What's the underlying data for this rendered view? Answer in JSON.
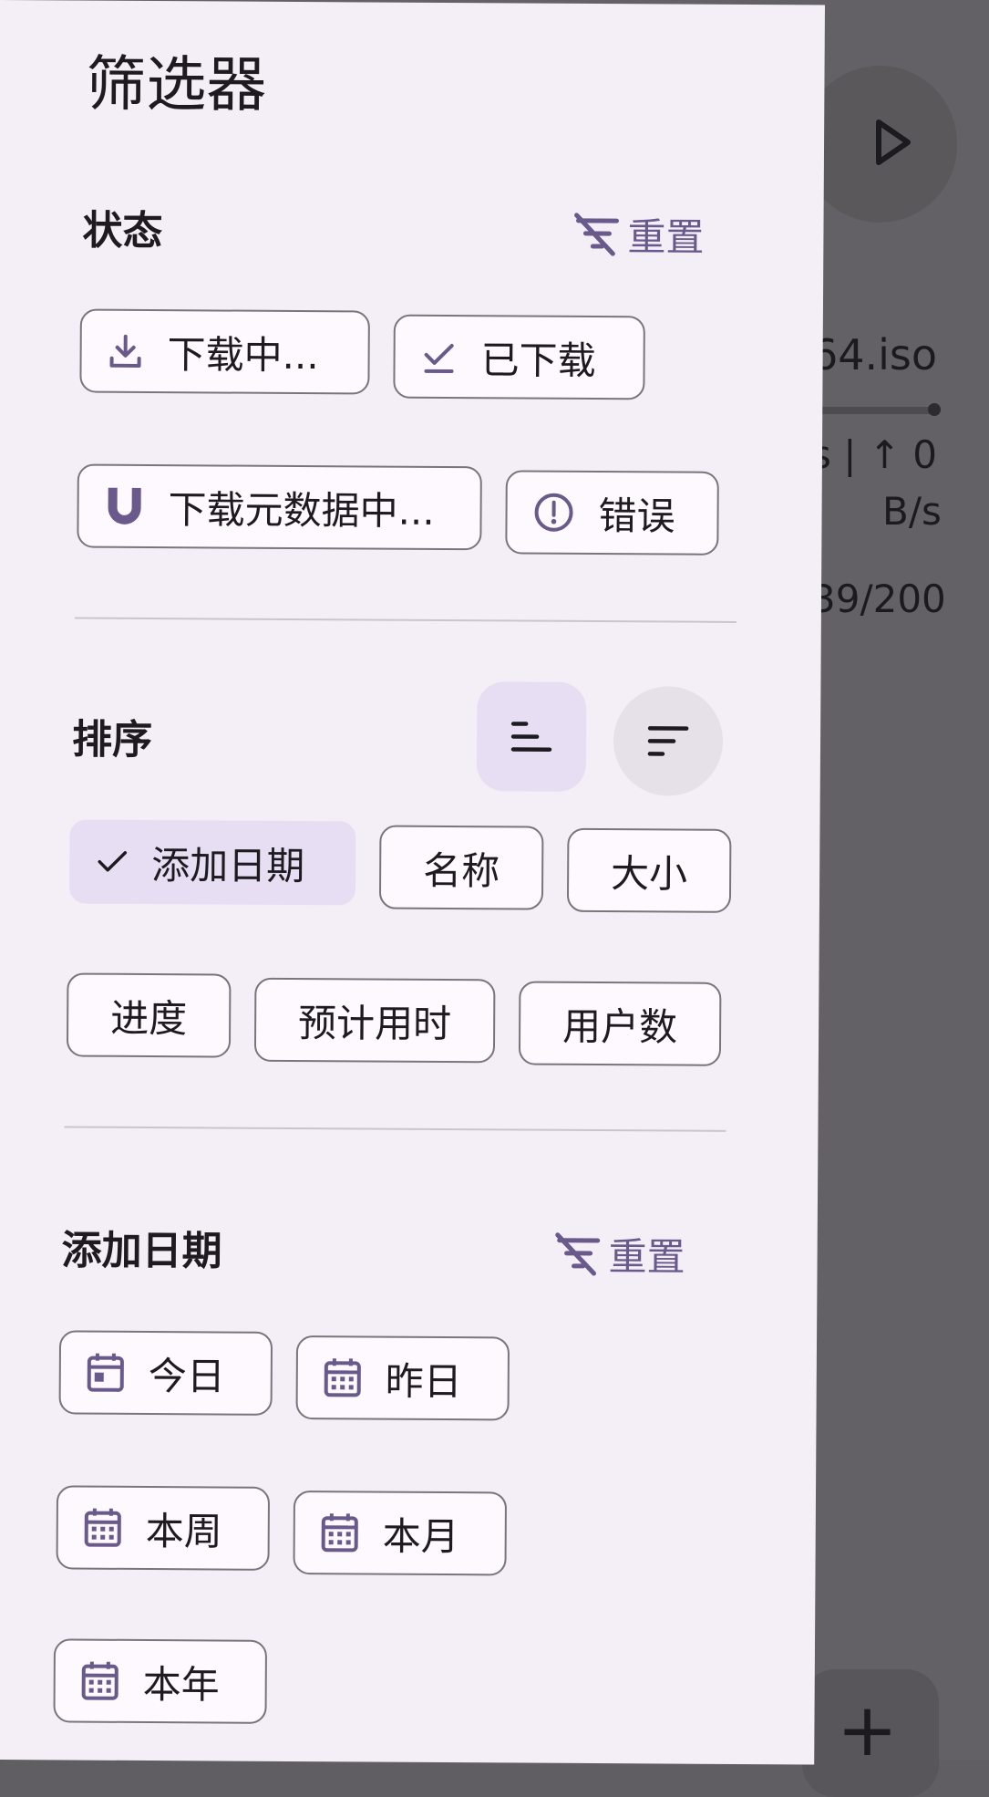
{
  "background": {
    "filename_fragment": "64.iso",
    "speed_line1": "s | ↑ 0",
    "speed_line2": "B/s",
    "count_fragment": "39/200",
    "fab_glyph": "+"
  },
  "drawer": {
    "title": "筛选器",
    "status": {
      "title": "状态",
      "reset_label": "重置",
      "chips": [
        {
          "label": "下载中...",
          "icon": "download-icon"
        },
        {
          "label": "已下载",
          "icon": "check-icon"
        },
        {
          "label": "下载元数据中...",
          "icon": "magnet-icon"
        },
        {
          "label": "错误",
          "icon": "error-icon"
        }
      ]
    },
    "sort": {
      "title": "排序",
      "chips": [
        {
          "label": "添加日期",
          "selected": true
        },
        {
          "label": "名称",
          "selected": false
        },
        {
          "label": "大小",
          "selected": false
        },
        {
          "label": "进度",
          "selected": false
        },
        {
          "label": "预计用时",
          "selected": false
        },
        {
          "label": "用户数",
          "selected": false
        }
      ]
    },
    "date_added": {
      "title": "添加日期",
      "reset_label": "重置",
      "chips": [
        {
          "label": "今日",
          "icon": "calendar-today-icon"
        },
        {
          "label": "昨日",
          "icon": "calendar-icon"
        },
        {
          "label": "本周",
          "icon": "calendar-icon"
        },
        {
          "label": "本月",
          "icon": "calendar-icon"
        },
        {
          "label": "本年",
          "icon": "calendar-icon"
        }
      ]
    }
  },
  "colors": {
    "drawer_bg": "#f4eef6",
    "accent": "#6a5a8c",
    "selected_chip": "#e8def3",
    "outline": "#79747e"
  }
}
